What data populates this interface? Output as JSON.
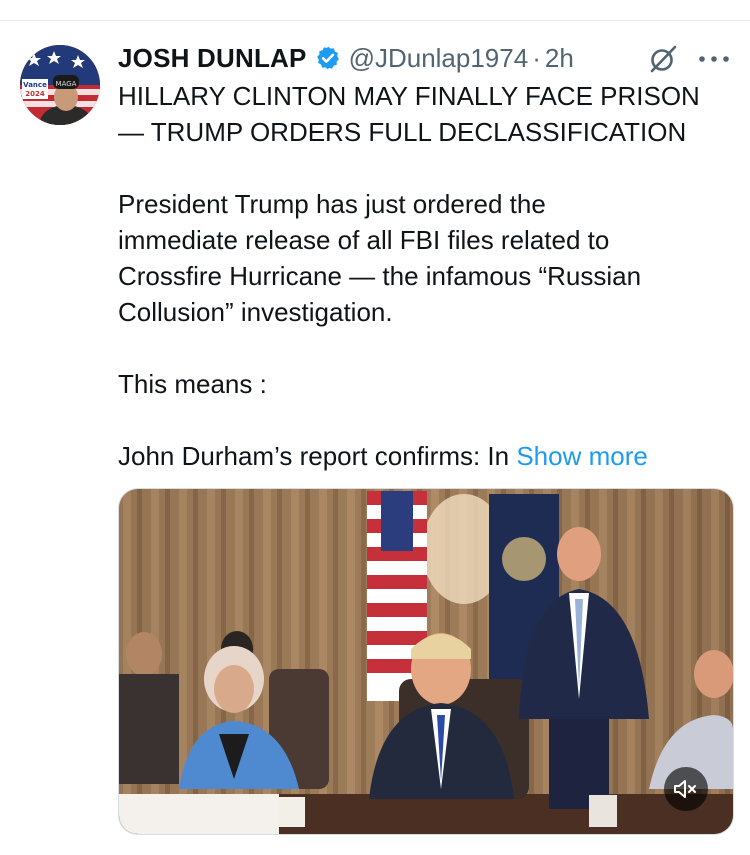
{
  "tweet": {
    "author_name": "JOSH DUNLAP",
    "handle": "@JDunlap1974",
    "separator": "·",
    "time": "2h",
    "headline_lines": [
      "HILLARY CLINTON MAY FINALLY FACE PRISON",
      "— TRUMP ORDERS FULL DECLASSIFICATION"
    ],
    "body_lines": [
      "President Trump has just ordered the",
      "immediate release of all FBI files related to",
      "Crossfire Hurricane — the infamous “Russian",
      "Collusion” investigation."
    ],
    "this_means": "This means :",
    "last_line_prefix": "John Durham’s report confirms: In ",
    "show_more": "Show more"
  },
  "avatar": {
    "badge_top": "Vance",
    "badge_bottom": "2024",
    "hat_text": "MAGA"
  },
  "icons": {
    "verified": "verified-badge-icon",
    "grok": "grok-icon",
    "more": "more-dots-icon",
    "mute": "speaker-muted-icon"
  },
  "colors": {
    "link": "#1d9bf0",
    "secondary_text": "#536471",
    "verified": "#1d9bf0"
  }
}
